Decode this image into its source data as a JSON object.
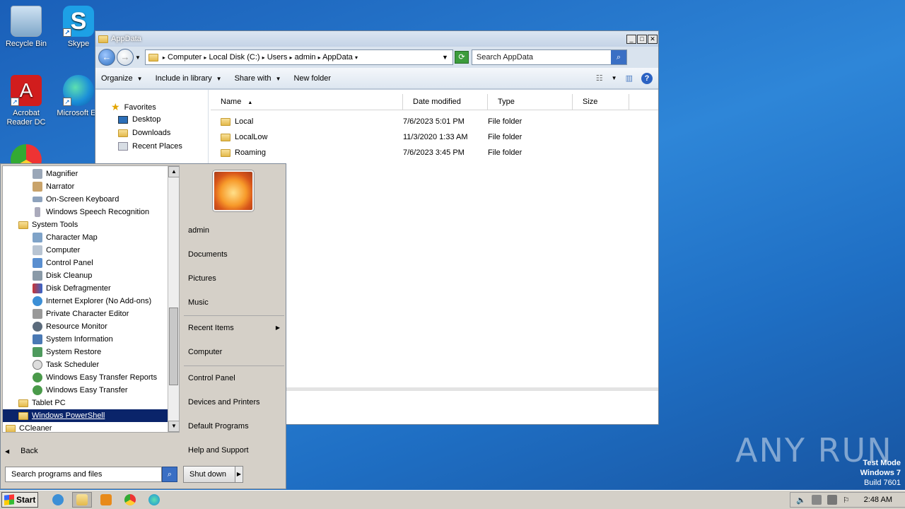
{
  "desktop": {
    "icons": [
      {
        "label": "Recycle Bin"
      },
      {
        "label": "Skype"
      },
      {
        "label": "Acrobat Reader DC"
      },
      {
        "label": "Microsoft Ed"
      }
    ]
  },
  "explorer": {
    "title": "AppData",
    "breadcrumb": [
      "Computer",
      "Local Disk (C:)",
      "Users",
      "admin",
      "AppData"
    ],
    "search_placeholder": "Search AppData",
    "commands": [
      "Organize",
      "Include in library",
      "Share with",
      "New folder"
    ],
    "nav": {
      "favorites": "Favorites",
      "items": [
        "Desktop",
        "Downloads",
        "Recent Places"
      ]
    },
    "columns": [
      "Name",
      "Date modified",
      "Type",
      "Size"
    ],
    "rows": [
      {
        "name": "Local",
        "date": "7/6/2023 5:01 PM",
        "type": "File folder"
      },
      {
        "name": "LocalLow",
        "date": "11/3/2020 1:33 AM",
        "type": "File folder"
      },
      {
        "name": "Roaming",
        "date": "7/6/2023 3:45 PM",
        "type": "File folder"
      }
    ]
  },
  "start_menu": {
    "programs": [
      {
        "label": "Magnifier"
      },
      {
        "label": "Narrator"
      },
      {
        "label": "On-Screen Keyboard"
      },
      {
        "label": "Windows Speech Recognition"
      },
      {
        "label": "System Tools"
      },
      {
        "label": "Character Map"
      },
      {
        "label": "Computer"
      },
      {
        "label": "Control Panel"
      },
      {
        "label": "Disk Cleanup"
      },
      {
        "label": "Disk Defragmenter"
      },
      {
        "label": "Internet Explorer (No Add-ons)"
      },
      {
        "label": "Private Character Editor"
      },
      {
        "label": "Resource Monitor"
      },
      {
        "label": "System Information"
      },
      {
        "label": "System Restore"
      },
      {
        "label": "Task Scheduler"
      },
      {
        "label": "Windows Easy Transfer Reports"
      },
      {
        "label": "Windows Easy Transfer"
      },
      {
        "label": "Tablet PC"
      },
      {
        "label": "Windows PowerShell"
      },
      {
        "label": "CCleaner"
      }
    ],
    "back_label": "Back",
    "search_placeholder": "Search programs and files",
    "right_items": [
      "admin",
      "Documents",
      "Pictures",
      "Music",
      "Recent Items",
      "Computer",
      "Control Panel",
      "Devices and Printers",
      "Default Programs",
      "Help and Support"
    ],
    "shutdown_label": "Shut down"
  },
  "taskbar": {
    "start_label": "Start",
    "clock": "2:48 AM"
  },
  "overlay": {
    "watermark": "ANY RUN",
    "test_mode": "Test Mode",
    "os": "Windows 7",
    "build": "Build 7601"
  }
}
